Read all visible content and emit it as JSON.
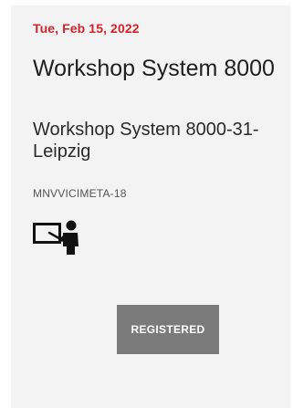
{
  "event": {
    "date": "Tue, Feb 15, 2022",
    "title": "Workshop System 8000",
    "subtitle": "Workshop System 8000-31-Leipzig",
    "code": "MNVVICIMETA-18",
    "format_icon": "presentation-teacher-icon",
    "status_button_label": "REGISTERED"
  },
  "colors": {
    "date_accent": "#d3222a",
    "card_background": "#f3f3f3",
    "button_background": "#7a7a7a"
  }
}
